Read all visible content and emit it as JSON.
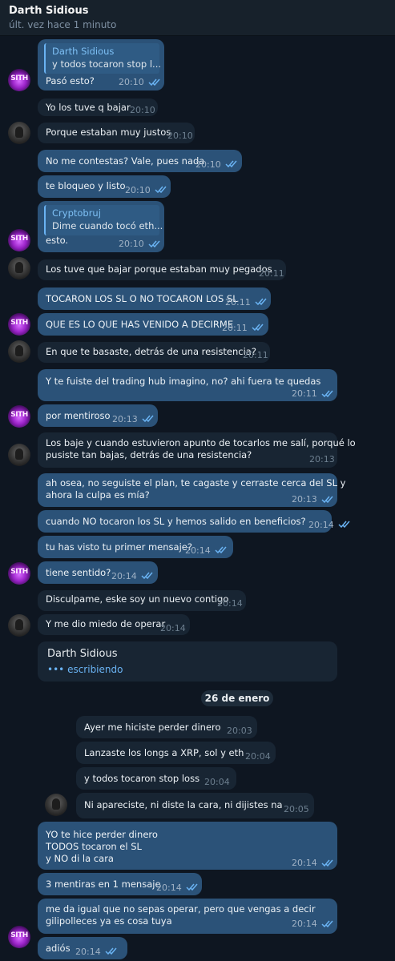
{
  "header": {
    "name": "Darth Sidious",
    "status": "últ. vez hace 1 minuto"
  },
  "icons": {
    "read_receipt": "double-check-icon",
    "typing": "typing-dots-icon",
    "accent": "#6ab3f3"
  },
  "messages": [
    {
      "reply_name": "Darth Sidious",
      "reply_text": "y todos tocaron stop l...",
      "text": "Pasó esto?",
      "time": "20:10"
    },
    {
      "text": "Yo los tuve q bajar",
      "time": "20:10"
    },
    {
      "text": "Porque estaban muy justos",
      "time": "20:10"
    },
    {
      "text": "No me contestas? Vale, pues nada",
      "time": "20:10"
    },
    {
      "text": "te bloqueo y listo",
      "time": "20:10"
    },
    {
      "reply_name": "Cryptobruj",
      "reply_text": "Dime cuando tocó eth...",
      "text": "esto.",
      "time": "20:10"
    },
    {
      "text": "Los tuve que bajar porque estaban muy pegados",
      "time": "20:11"
    },
    {
      "text": "TOCARON LOS SL O NO TOCARON LOS SL",
      "time": "20:11"
    },
    {
      "text": "QUE ES LO QUE HAS VENIDO A DECIRME",
      "time": "20:11"
    },
    {
      "text": "En que te basaste, detrás de una resistencia?",
      "time": "20:11"
    },
    {
      "text": "Y te fuiste del trading hub imagino, no? ahi fuera te quedas",
      "time": "20:11"
    },
    {
      "text": "por mentiroso",
      "time": "20:13"
    },
    {
      "text": "Los baje y cuando estuvieron apunto de tocarlos me salí, porqué lo\npusiste tan bajas, detrás de una resistencia?",
      "time": "20:13"
    },
    {
      "text": "ah osea, no seguiste el plan, te cagaste y cerraste cerca del SL y\nahora la culpa es mía?",
      "time": "20:13"
    },
    {
      "text": "cuando NO tocaron los SL y hemos salido en beneficios?",
      "time": "20:14"
    },
    {
      "text": "tu has visto tu primer mensaje?",
      "time": "20:14"
    },
    {
      "text": "tiene sentido?",
      "time": "20:14"
    },
    {
      "text": "Disculpame, eske soy un nuevo contigo",
      "time": "20:14"
    },
    {
      "text": "Y me dio miedo de operar",
      "time": "20:14"
    },
    {
      "text": "Ayer me hiciste perder dinero",
      "time": "20:03"
    },
    {
      "text": "Lanzaste los longs a XRP, sol y eth",
      "time": "20:04"
    },
    {
      "text": "y todos tocaron stop loss",
      "time": "20:04"
    },
    {
      "text": "Ni apareciste, ni diste la cara, ni dijistes na",
      "time": "20:05"
    },
    {
      "text": "YO te hice perder dinero\nTODOS tocaron el SL\ny NO di la cara",
      "time": "20:14"
    },
    {
      "text": "3 mentiras en 1 mensaje",
      "time": "20:14"
    },
    {
      "text": "me da igual que no sepas operar, pero que vengas a decir\ngilipolleces ya es cosa tuya",
      "time": "20:14"
    },
    {
      "text": "adiós",
      "time": "20:14"
    }
  ],
  "typing": {
    "name": "Darth Sidious",
    "status": "escribiendo"
  },
  "date_separator": "26 de enero"
}
